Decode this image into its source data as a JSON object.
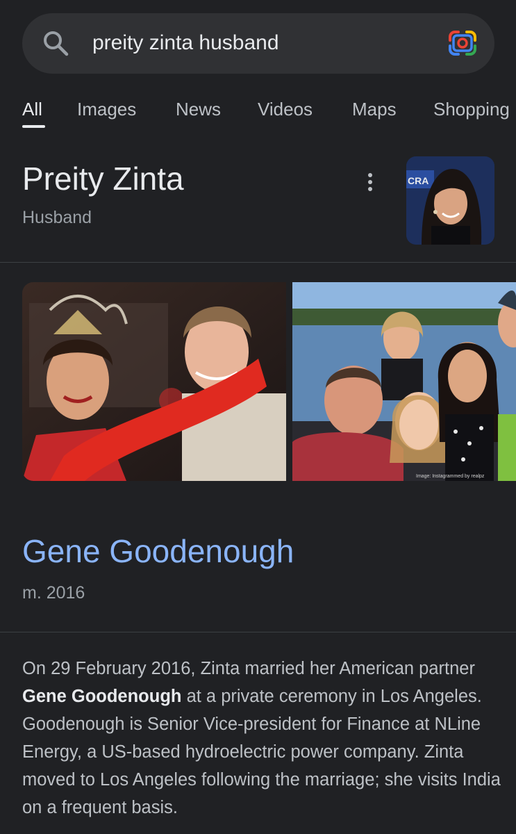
{
  "search": {
    "query": "preity zinta husband",
    "search_icon": "search-icon",
    "lens_icon": "google-lens-icon"
  },
  "tabs": [
    {
      "label": "All",
      "active": true
    },
    {
      "label": "Images",
      "active": false
    },
    {
      "label": "News",
      "active": false
    },
    {
      "label": "Videos",
      "active": false
    },
    {
      "label": "Maps",
      "active": false
    },
    {
      "label": "Shopping",
      "active": false
    }
  ],
  "entity": {
    "title": "Preity Zinta",
    "subtitle": "Husband",
    "more_icon": "more-vert-icon",
    "thumbnail_sign": "CRA"
  },
  "images": {
    "credit": "Image: Instagrammed by realpz"
  },
  "answer": {
    "name": "Gene Goodenough",
    "meta": "m. 2016"
  },
  "description": {
    "before": "On 29 February 2016, Zinta married her American partner ",
    "bold": "Gene Goodenough",
    "after": " at a private ceremony in Los Angeles. Goodenough is Senior Vice-president for Finance at NLine Energy, a US-based hydroelectric power company. Zinta moved to Los Angeles following the marriage; she visits India on a frequent basis."
  },
  "colors": {
    "background": "#202124",
    "search_bar": "#303134",
    "link_blue": "#8ab4f8",
    "text_primary": "#e8eaed",
    "text_secondary": "#9aa0a6"
  }
}
